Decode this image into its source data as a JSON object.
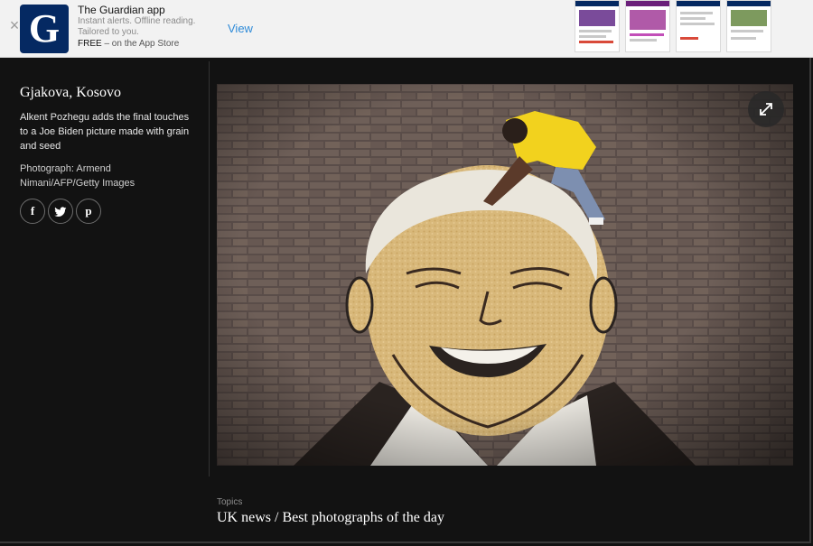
{
  "banner": {
    "close_glyph": "×",
    "logo_letter": "G",
    "app_name": "The Guardian app",
    "line1": "Instant alerts. Offline reading.",
    "line2": "Tailored to you.",
    "free_label": "FREE",
    "free_suffix": " – on the App Store",
    "view_label": "View"
  },
  "gallery": {
    "location": "Gjakova, Kosovo",
    "caption": "Alkent Pozhegu adds the final touches to a Joe Biden picture made with grain and seed",
    "credit": "Photograph: Armend Nimani/AFP/Getty Images",
    "share": {
      "facebook": "f",
      "twitter": "🐦",
      "pinterest": "p"
    }
  },
  "topics": {
    "label": "Topics",
    "link1": "UK news",
    "separator": " / ",
    "link2": "Best photographs of the day"
  },
  "colors": {
    "guardian_navy": "#052962",
    "link_blue": "#2f8bd8",
    "background": "#121212"
  },
  "icons": {
    "close": "close-icon",
    "share_facebook": "facebook-icon",
    "share_twitter": "twitter-icon",
    "share_pinterest": "pinterest-icon",
    "expand": "expand-icon"
  }
}
